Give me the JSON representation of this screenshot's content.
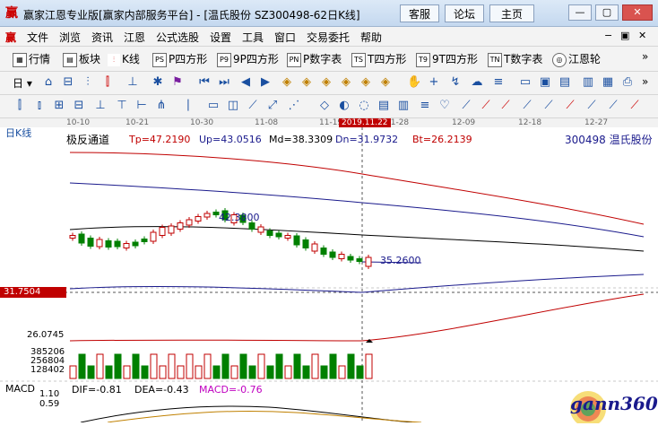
{
  "window": {
    "title": "赢家江恩专业版[赢家内部服务平台] - [温氏股份  SZ300498-62日K线]",
    "buttons": [
      "客服",
      "论坛",
      "主页"
    ]
  },
  "menu": [
    "文件",
    "浏览",
    "资讯",
    "江恩",
    "公式选股",
    "设置",
    "工具",
    "窗口",
    "交易委托",
    "帮助"
  ],
  "toolbar1": [
    "行情",
    "板块",
    "K线",
    "P四方形",
    "9P四方形",
    "P数字表",
    "T四方形",
    "9T四方形",
    "T数字表",
    "江恩轮"
  ],
  "toolbar2": {
    "period_label": "日"
  },
  "chart": {
    "period_label": "日K线",
    "indicator_title": "极反通道",
    "tp": "Tp=47.2190",
    "up": "Up=43.0516",
    "md": "Md=38.3309",
    "dn": "Dn=31.9732",
    "bt": "Bt=26.2139",
    "stock": "300498  温氏股份",
    "date_axis": [
      "10-10",
      "10-21",
      "10-30",
      "11-08",
      "11-19",
      "11-28",
      "12-09",
      "12-18",
      "12-27"
    ],
    "cursor_date": "2019.11.22",
    "high_label": "42.3800",
    "low_label": "35.2600",
    "price_marker": "31.7504",
    "low_axis": "26.0745",
    "volume_axis": [
      "385206",
      "256804",
      "128402"
    ],
    "macd": {
      "title": "MACD",
      "dif": "DIF=-0.81",
      "dea": "DEA=-0.43",
      "macd": "MACD=-0.76",
      "axis": [
        "1.10",
        "0.59"
      ]
    },
    "watermark": "gann360"
  },
  "chart_data": {
    "type": "candlestick",
    "price_lines": {
      "Tp": 47.219,
      "Up": 43.0516,
      "Md": 38.3309,
      "Dn": 31.9732,
      "Bt": 26.2139
    },
    "annotated_high": 42.38,
    "annotated_low": 35.26,
    "colors": {
      "up": "#c00000",
      "down": "#008000",
      "macd_label": "#c000c0"
    }
  }
}
